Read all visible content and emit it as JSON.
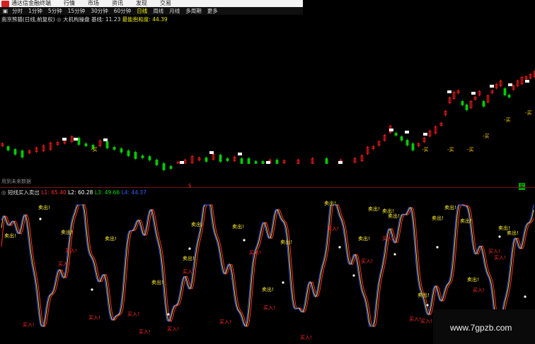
{
  "titlebar": {
    "app_title": "通达信金融终端",
    "menus": [
      "行情",
      "市场",
      "资讯",
      "发现",
      "交易"
    ]
  },
  "periods": {
    "items": [
      "分时",
      "1分钟",
      "5分钟",
      "15分钟",
      "30分钟",
      "60分钟",
      "日线",
      "周线",
      "月线",
      "多周期",
      "更多"
    ],
    "active": "日线",
    "grid_icon": "grid-icon"
  },
  "main_chart": {
    "stock_label": "南京熊猫(日线,前复权)",
    "indicator_name": "大机构操盘",
    "baseline_label": "基线:",
    "baseline_value": "11.23",
    "best_buy_label": "最能抱和度:",
    "best_buy_value": "44.39",
    "future_data_label": "用到未来数据",
    "colors": {
      "up": "#ff2020",
      "down": "#00cc00",
      "flat": "#ffffff"
    }
  },
  "indicator": {
    "name": "短线买入卖出",
    "l1_label": "L1:",
    "l1_value": "65.40",
    "l2_label": "L2:",
    "l2_value": "60.28",
    "l3_label": "L3:",
    "l3_value": "49.66",
    "l4_label": "L4:",
    "l4_value": "44.37",
    "buy_text": "买入!",
    "sell_text": "卖出!",
    "buy_marker": "-买",
    "colors": {
      "l1": "#ff3030",
      "l2": "#ffffff",
      "l3": "#00dd00",
      "l4": "#3060ff"
    }
  },
  "watermark": {
    "text": "www.7gpzb.com"
  },
  "markers": {
    "s_mark": "S",
    "bottom_right_mark": "买"
  }
}
